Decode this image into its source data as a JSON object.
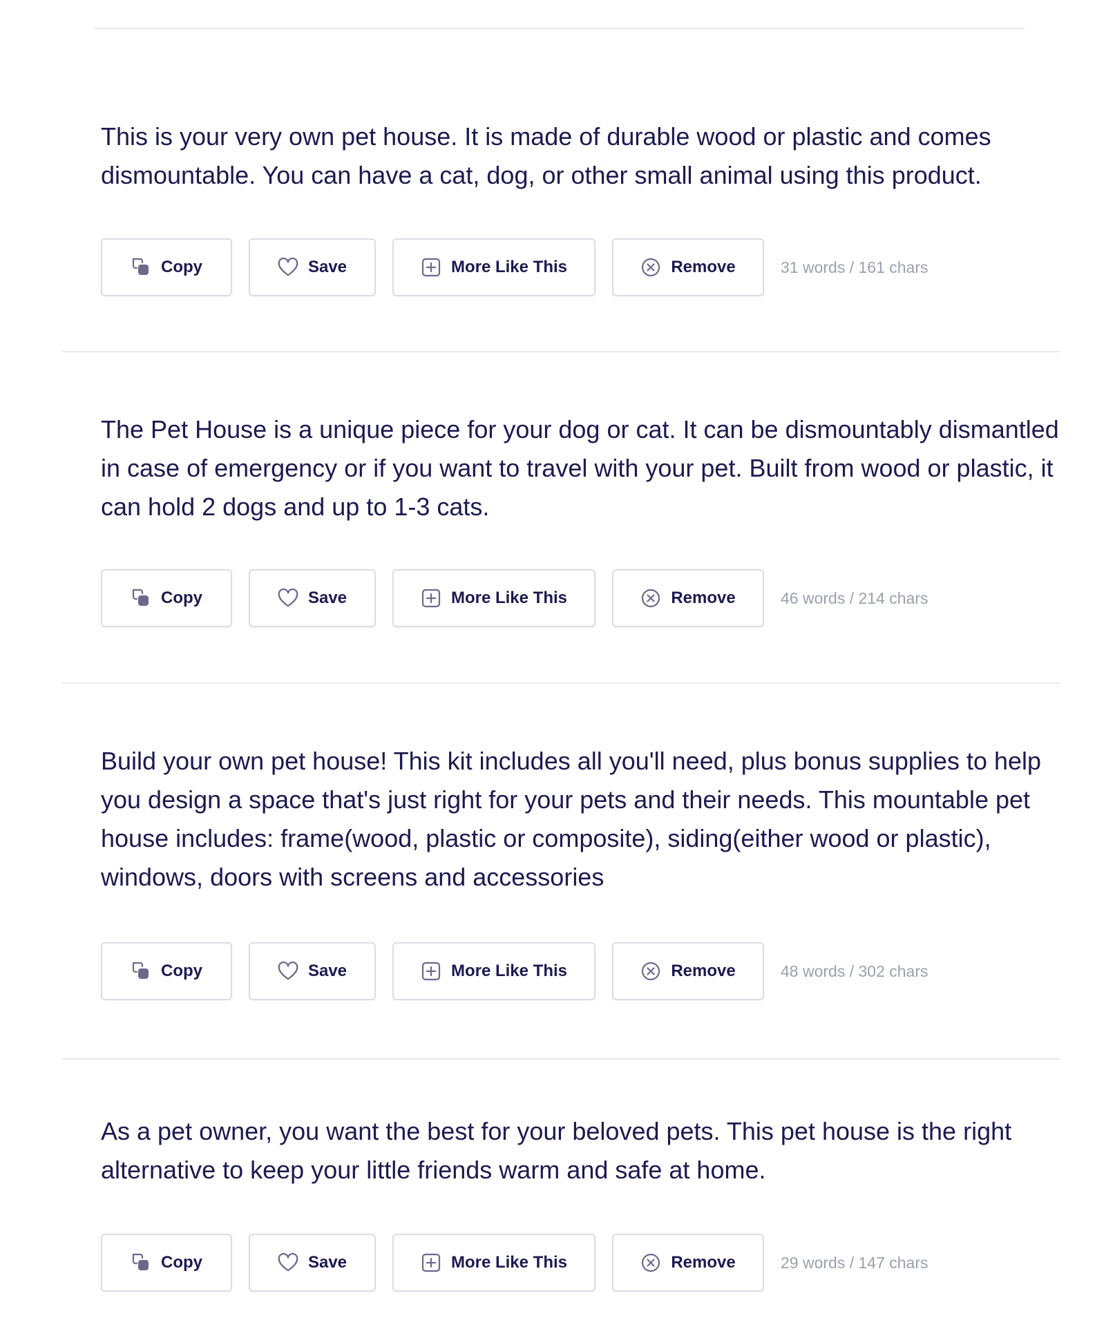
{
  "actions": {
    "copy_label": "Copy",
    "save_label": "Save",
    "more_label": "More Like This",
    "remove_label": "Remove"
  },
  "results": [
    {
      "text": "This is your very own pet house. It is made of durable wood or plastic and comes dismountable. You can have a cat, dog, or other small animal using this product.",
      "counts": "31 words / 161 chars"
    },
    {
      "text": "The Pet House is a unique piece for your dog or cat. It can be dismountably dismantled in case of emergency or if you want to travel with your pet. Built from wood or plastic, it can hold 2 dogs and up to 1-3 cats.",
      "counts": "46 words / 214 chars"
    },
    {
      "text": "Build your own pet house! This kit includes all you'll need, plus bonus supplies to help you design a space that's just right for your pets and their needs. This mountable pet house includes: frame(wood, plastic or composite), siding(either wood or plastic), windows, doors with screens and accessories",
      "counts": "48 words / 302 chars"
    },
    {
      "text": "As a pet owner, you want the best for your beloved pets. This pet house is the right alternative to keep your little friends warm and safe at home.",
      "counts": "29 words / 147 chars"
    }
  ],
  "icons": {
    "copy": "copy-icon",
    "save": "heart-icon",
    "more": "plus-square-icon",
    "remove": "x-circle-icon"
  },
  "colors": {
    "text": "#1d1a4e",
    "muted": "#9ba0ab",
    "border": "#dcdce6",
    "divider": "#e8e8ee",
    "icon": "#6b6a8a"
  }
}
